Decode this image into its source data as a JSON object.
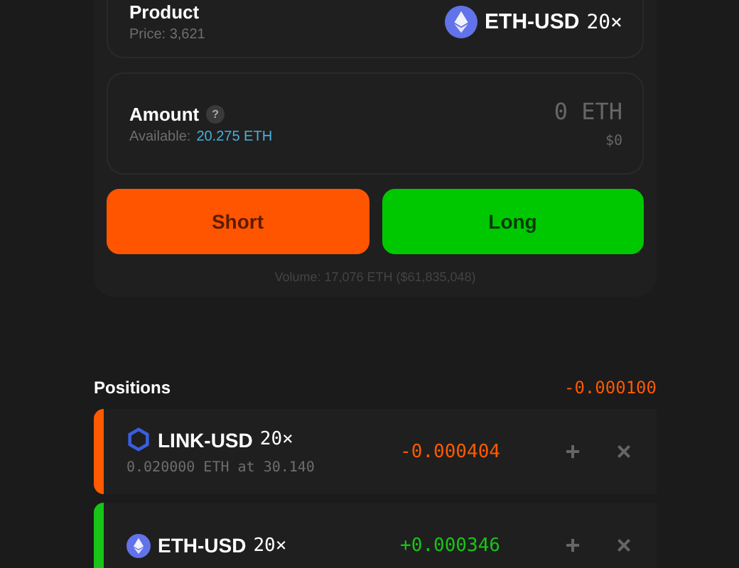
{
  "trade": {
    "product": {
      "label": "Product",
      "price": "Price: 3,621",
      "symbol": "ETH-USD",
      "leverage": "20×"
    },
    "amount": {
      "label": "Amount",
      "help": "?",
      "available_label": "Available:",
      "available": "20.275 ETH",
      "value": "0 ETH",
      "usd": "$0"
    },
    "buttons": [
      {
        "label": "Short",
        "kind": "short"
      },
      {
        "label": "Long",
        "kind": "long"
      }
    ],
    "volume": "Volume: 17,076 ETH ($61,835,048)"
  },
  "positions": {
    "title": "Positions",
    "total": "-0.000100",
    "loss": true,
    "items": [
      {
        "kind": "link",
        "symbol": "LINK-USD",
        "leverage": "20×",
        "detail": "0.020000 ETH at 30.140",
        "pnl": "-0.000404",
        "color": "#ff5a00",
        "add": "+",
        "close": "×"
      },
      {
        "kind": "eth",
        "symbol": "ETH-USD",
        "leverage": "20×",
        "pnl": "+0.000346",
        "color": "#18c418",
        "add": "+",
        "close": "×"
      }
    ]
  }
}
